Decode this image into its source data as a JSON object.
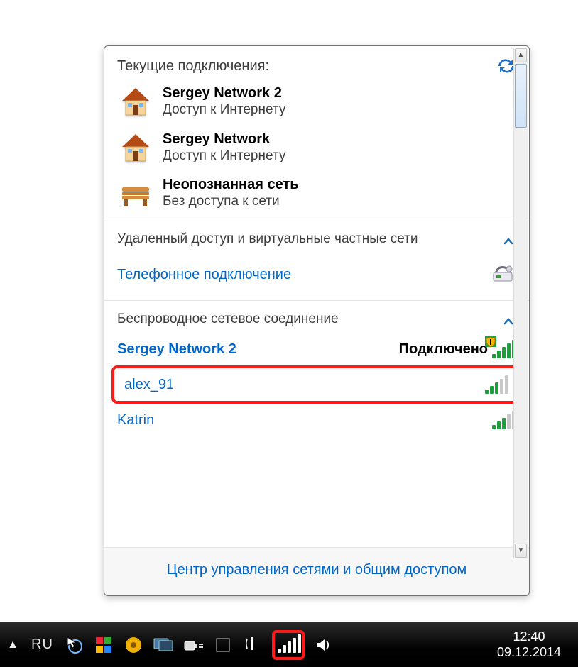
{
  "popup": {
    "current_header": "Текущие подключения:",
    "connections": [
      {
        "name": "Sergey Network  2",
        "status": "Доступ к Интернету",
        "icon": "house"
      },
      {
        "name": "Sergey Network",
        "status": "Доступ к Интернету",
        "icon": "house"
      },
      {
        "name": "Неопознанная сеть",
        "status": "Без доступа к сети",
        "icon": "bench"
      }
    ],
    "vpn_group": "Удаленный доступ и виртуальные частные сети",
    "dialup_link": "Телефонное подключение",
    "wifi_group": "Беспроводное сетевое соединение",
    "wifi": [
      {
        "ssid": "Sergey Network 2",
        "status": "Подключено",
        "signal": 5,
        "warn": true,
        "highlight": false
      },
      {
        "ssid": "alex_91",
        "status": "",
        "signal": 3,
        "warn": false,
        "highlight": true
      },
      {
        "ssid": "Katrin",
        "status": "",
        "signal": 3,
        "warn": false,
        "highlight": false
      }
    ],
    "footer": "Центр управления сетями и общим доступом"
  },
  "taskbar": {
    "lang": "RU",
    "time": "12:40",
    "date": "09.12.2014"
  }
}
